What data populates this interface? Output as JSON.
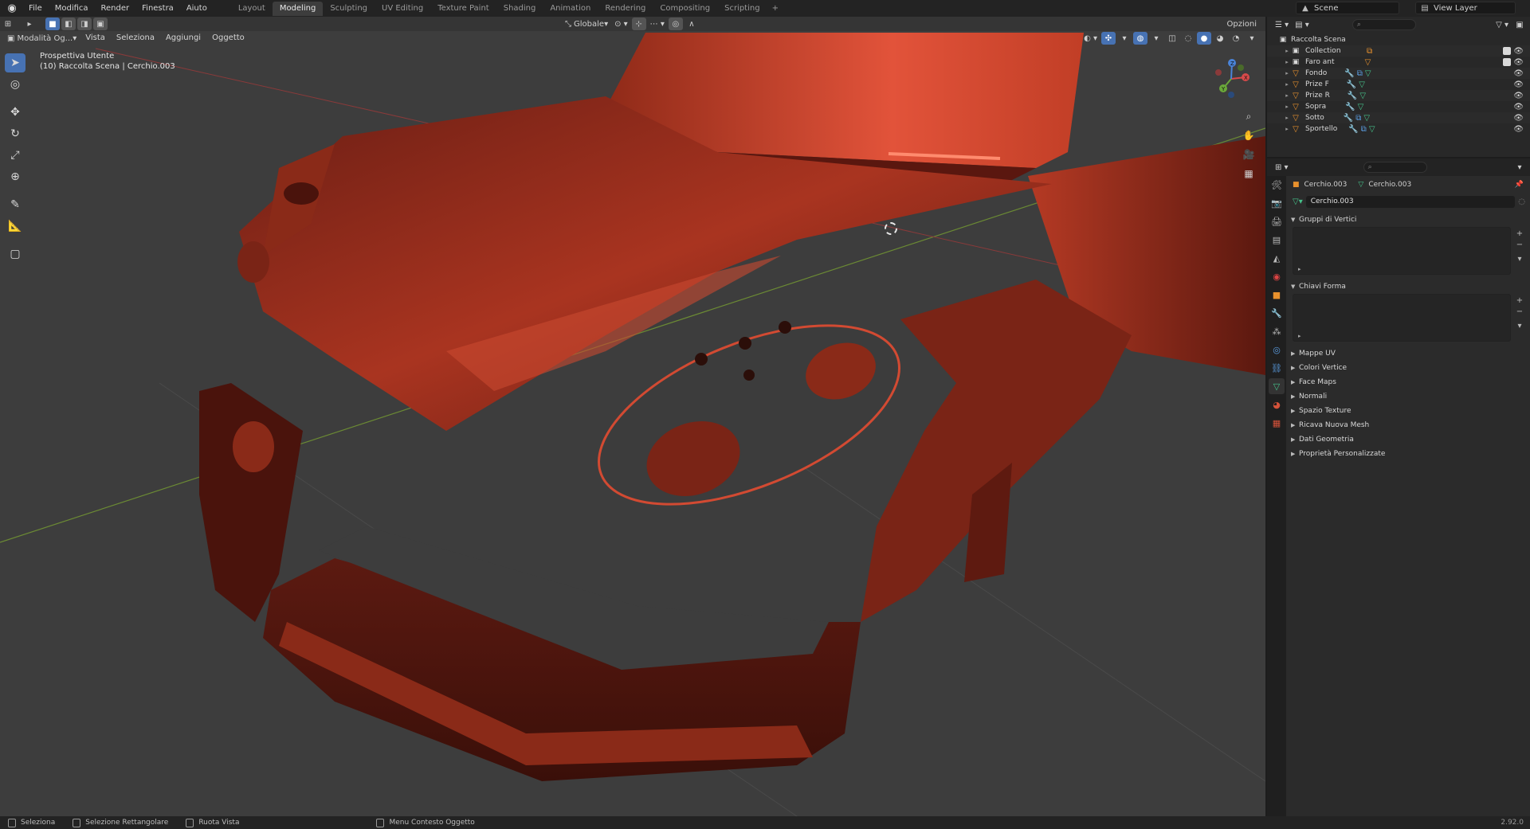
{
  "topbar": {
    "menu": [
      "File",
      "Modifica",
      "Render",
      "Finestra",
      "Aiuto"
    ],
    "workspaces": [
      "Layout",
      "Modeling",
      "Sculpting",
      "UV Editing",
      "Texture Paint",
      "Shading",
      "Animation",
      "Rendering",
      "Compositing",
      "Scripting"
    ],
    "active_workspace": "Modeling",
    "scene": "Scene",
    "view_layer": "View Layer"
  },
  "viewport": {
    "mode": "Modalità Og...",
    "menus": [
      "Vista",
      "Seleziona",
      "Aggiungi",
      "Oggetto"
    ],
    "transform_orientation": "Globale",
    "options": "Opzioni",
    "info_line1": "Prospettiva Utente",
    "info_line2": "(10) Raccolta Scena | Cerchio.003",
    "gizmo": {
      "x": "X",
      "y": "Y",
      "z": "Z"
    }
  },
  "outliner": {
    "root": "Raccolta Scena",
    "items": [
      {
        "label": "Collection",
        "type": "collection"
      },
      {
        "label": "Faro ant",
        "type": "collection"
      },
      {
        "label": "Fondo",
        "type": "object"
      },
      {
        "label": "Prize F",
        "type": "object"
      },
      {
        "label": "Prize R",
        "type": "object"
      },
      {
        "label": "Sopra",
        "type": "object"
      },
      {
        "label": "Sotto",
        "type": "object"
      },
      {
        "label": "Sportello",
        "type": "object"
      }
    ]
  },
  "properties": {
    "object_name": "Cerchio.003",
    "mesh_name": "Cerchio.003",
    "data_name": "Cerchio.003",
    "panels_open": [
      "Gruppi di Vertici",
      "Chiavi Forma"
    ],
    "panels_closed": [
      "Mappe UV",
      "Colori Vertice",
      "Face Maps",
      "Normali",
      "Spazio Texture",
      "Ricava Nuova Mesh",
      "Dati Geometria",
      "Proprietà Personalizzate"
    ]
  },
  "statusbar": {
    "select": "Seleziona",
    "box_select": "Selezione Rettangolare",
    "rotate": "Ruota Vista",
    "context_menu": "Menu Contesto Oggetto",
    "version": "2.92.0"
  }
}
